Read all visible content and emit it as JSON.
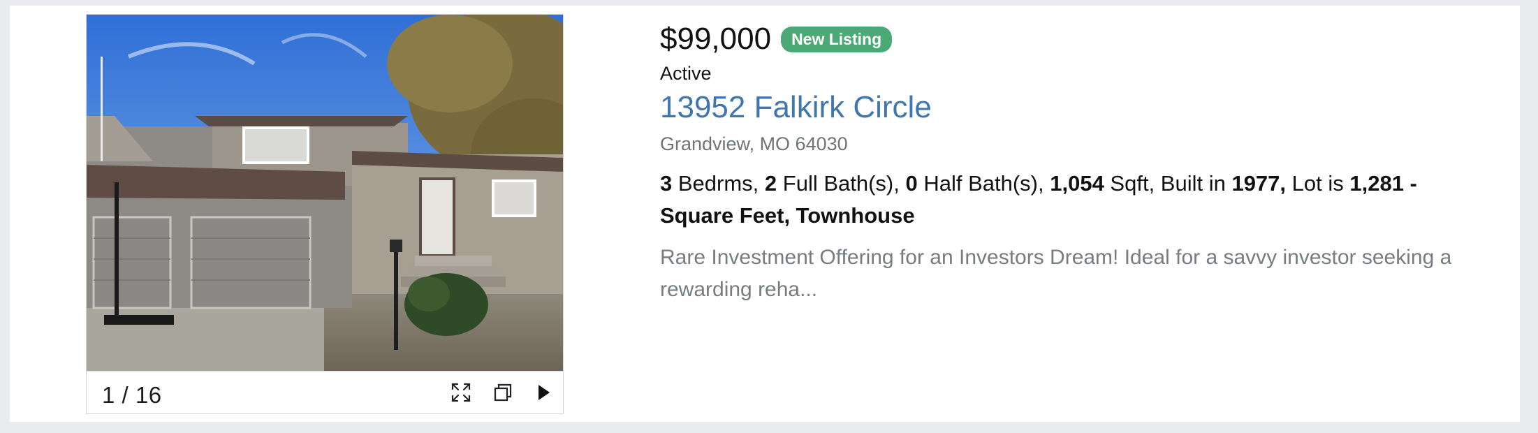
{
  "listing": {
    "price": "$99,000",
    "badge": "New Listing",
    "status": "Active",
    "address": "13952 Falkirk Circle",
    "city_line": "Grandview, MO 64030",
    "details": {
      "beds": "3",
      "beds_label": " Bedrms, ",
      "full_baths": "2",
      "full_baths_label": " Full Bath(s), ",
      "half_baths": "0",
      "half_baths_label": " Half Bath(s), ",
      "sqft": "1,054",
      "sqft_label": " Sqft, Built in ",
      "year_built": "1977,",
      "lot_label": " Lot is ",
      "lot_size": "1,281 - Square Feet, Townhouse"
    },
    "description": "Rare Investment Offering for an Investors Dream! Ideal for a savvy investor seeking a rewarding reha..."
  },
  "gallery": {
    "counter": "1 / 16",
    "controls": [
      "expand-icon",
      "copy-icon",
      "play-next-icon"
    ]
  },
  "colors": {
    "badge_bg": "#4ca875",
    "address_link": "#3f76ae",
    "muted_text": "#777c80",
    "page_bg": "#e9ebee"
  }
}
